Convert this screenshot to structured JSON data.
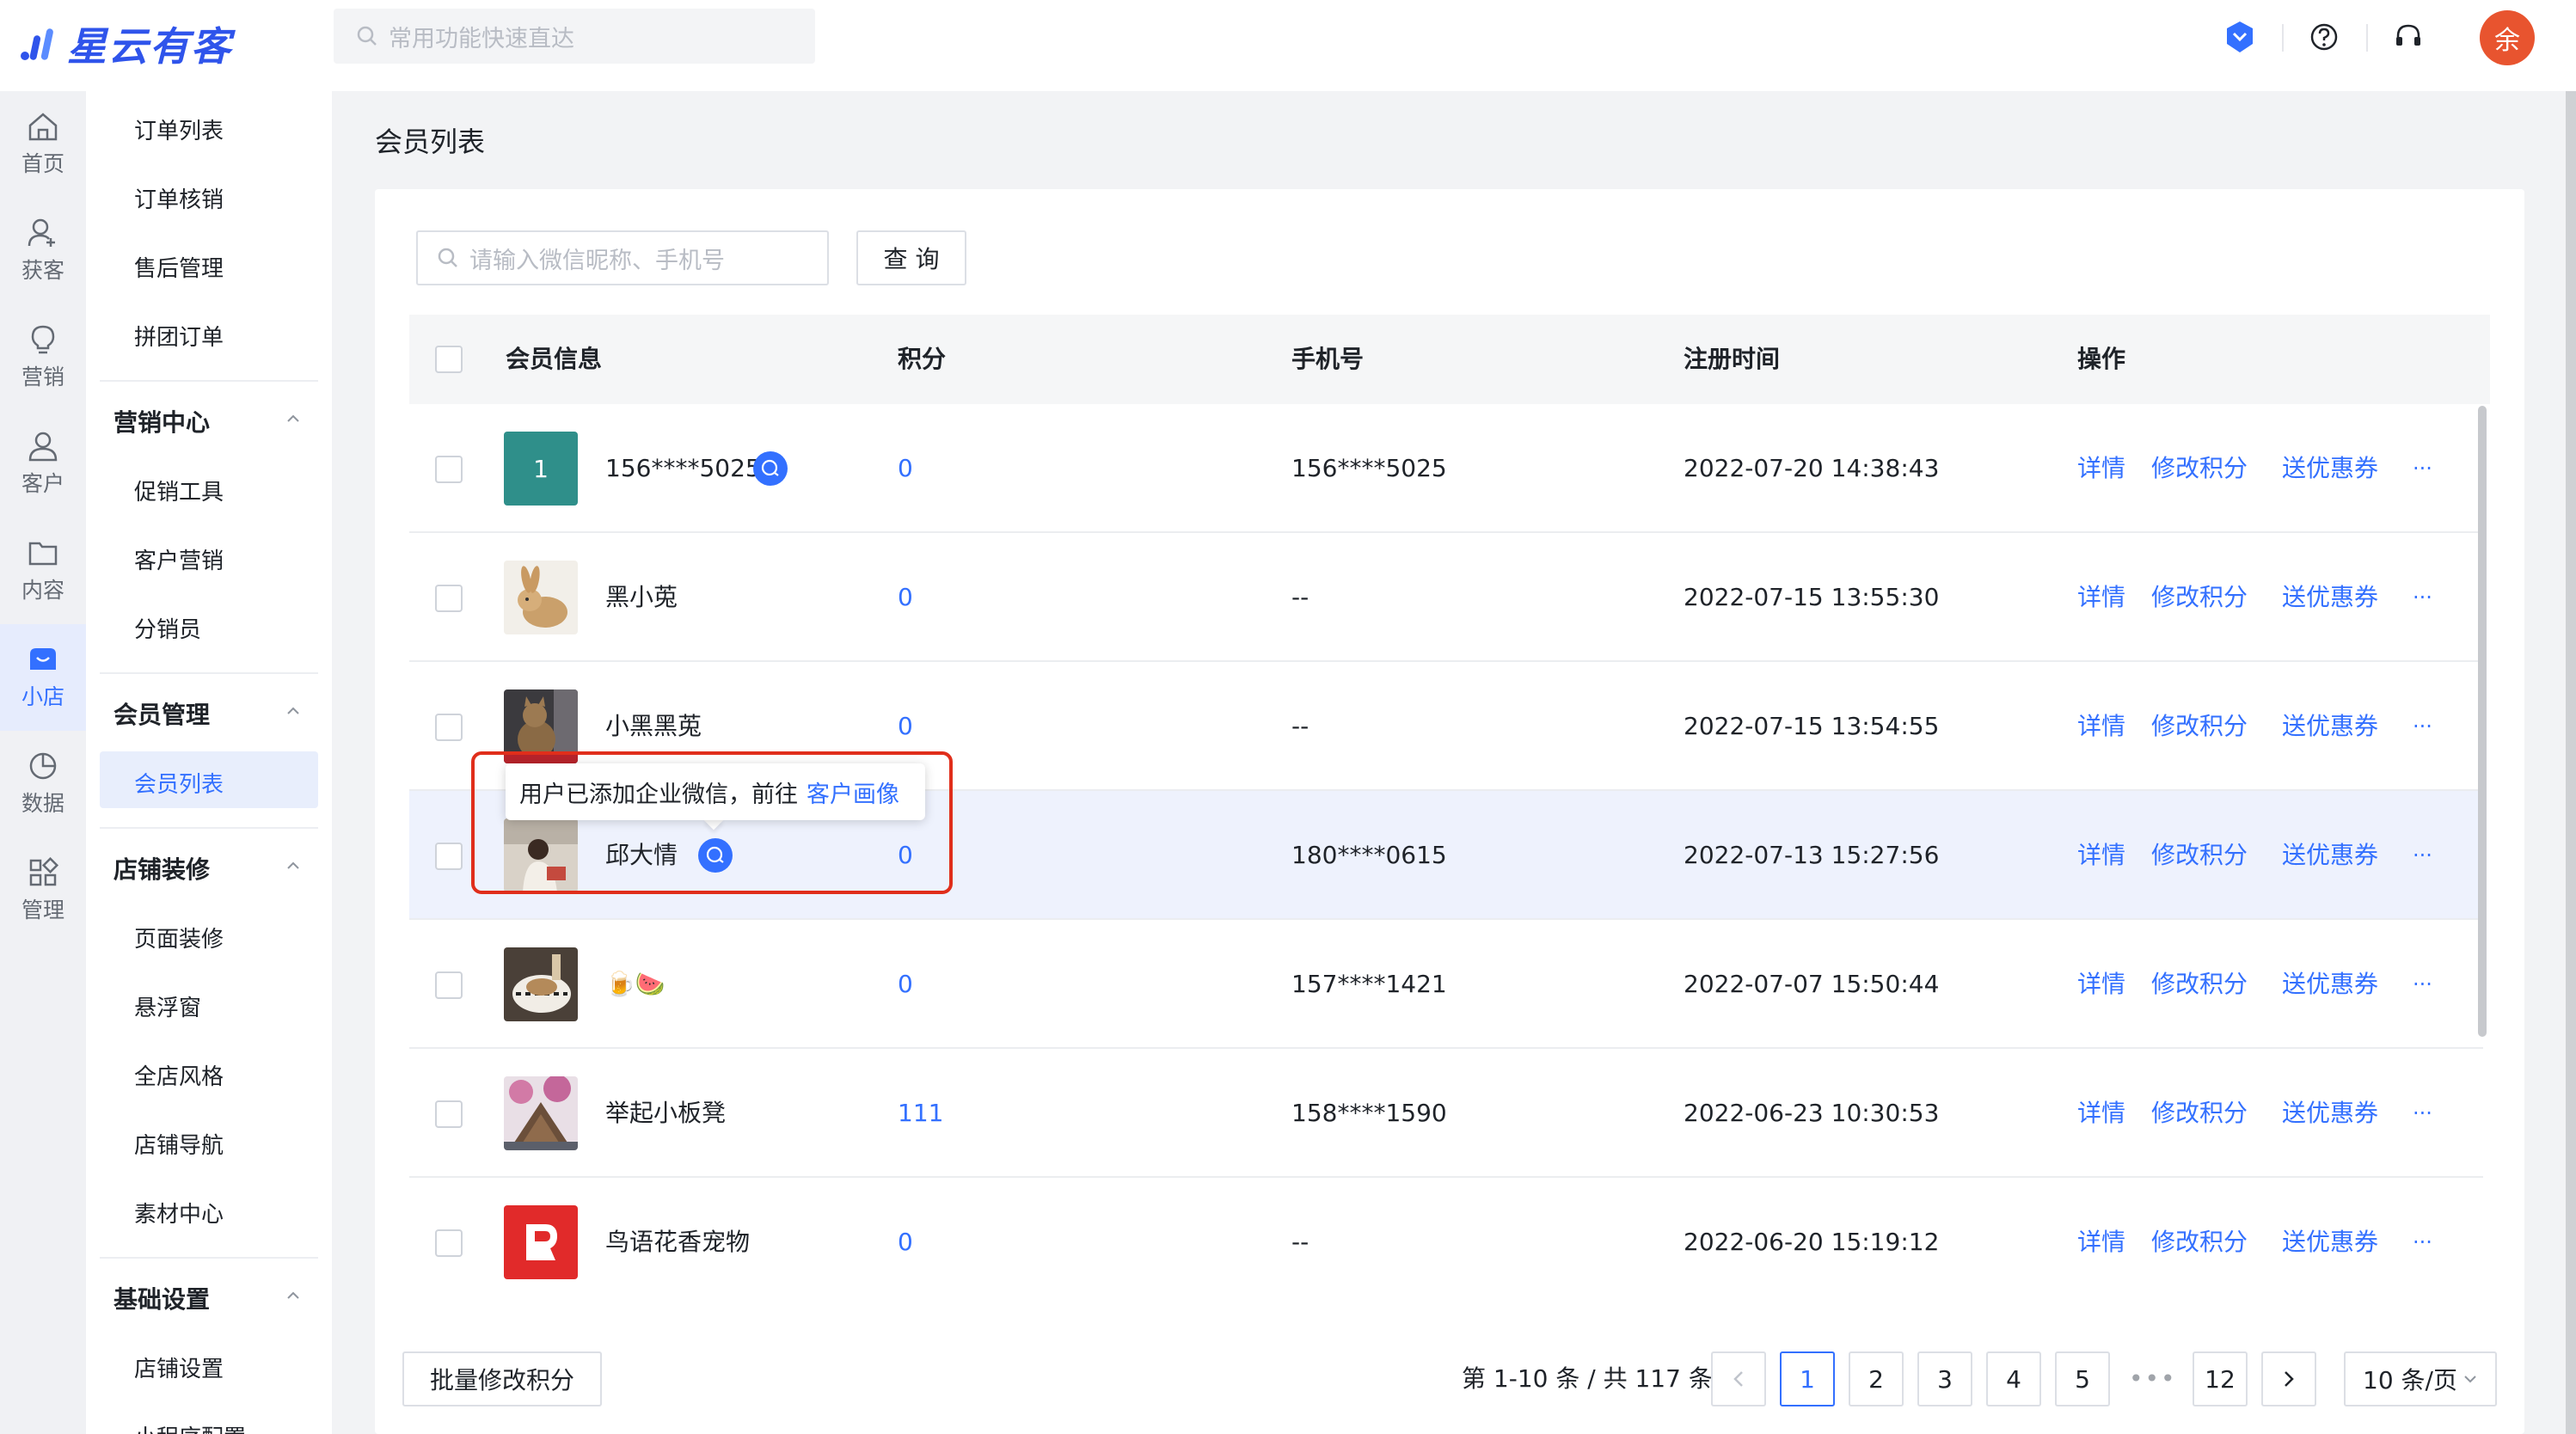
{
  "app": {
    "name": "星云有客"
  },
  "top": {
    "search_placeholder": "常用功能快速直达",
    "user_initial": "余"
  },
  "rail": [
    {
      "label": "首页",
      "icon": "home-icon"
    },
    {
      "label": "获客",
      "icon": "user-plus-icon"
    },
    {
      "label": "营销",
      "icon": "bulb-icon"
    },
    {
      "label": "客户",
      "icon": "user-icon"
    },
    {
      "label": "内容",
      "icon": "folder-icon"
    },
    {
      "label": "小店",
      "icon": "shop-icon"
    },
    {
      "label": "数据",
      "icon": "pie-chart-icon"
    },
    {
      "label": "管理",
      "icon": "grid-icon"
    }
  ],
  "sidebar": {
    "order_items": [
      "订单列表",
      "订单核销",
      "售后管理",
      "拼团订单"
    ],
    "marketing": {
      "title": "营销中心",
      "items": [
        "促销工具",
        "客户营销",
        "分销员"
      ]
    },
    "member": {
      "title": "会员管理",
      "items": [
        "会员列表"
      ]
    },
    "decor": {
      "title": "店铺装修",
      "items": [
        "页面装修",
        "悬浮窗",
        "全店风格",
        "店铺导航",
        "素材中心"
      ]
    },
    "basic": {
      "title": "基础设置",
      "items": [
        "店铺设置",
        "小程序配置"
      ]
    }
  },
  "page": {
    "title": "会员列表"
  },
  "search": {
    "placeholder": "请输入微信昵称、手机号",
    "button": "查 询"
  },
  "table": {
    "columns": [
      "会员信息",
      "积分",
      "手机号",
      "注册时间",
      "操作"
    ],
    "actions": [
      "详情",
      "修改积分",
      "送优惠券",
      "···"
    ],
    "rows": [
      {
        "name": "156****5025",
        "thumb": "1",
        "points": "0",
        "phone": "156****5025",
        "time": "2022-07-20 14:38:43",
        "wechat": true
      },
      {
        "name": "黑小莵",
        "points": "0",
        "phone": "--",
        "time": "2022-07-15 13:55:30",
        "wechat": false
      },
      {
        "name": "小黑黑莵",
        "points": "0",
        "phone": "--",
        "time": "2022-07-15 13:54:55",
        "wechat": false
      },
      {
        "name": "邱大情",
        "points": "0",
        "phone": "180****0615",
        "time": "2022-07-13 15:27:56",
        "wechat": true
      },
      {
        "name": "🍺🍉",
        "points": "0",
        "phone": "157****1421",
        "time": "2022-07-07 15:50:44",
        "wechat": false
      },
      {
        "name": "举起小板凳",
        "points": "111",
        "phone": "158****1590",
        "time": "2022-06-23 10:30:53",
        "wechat": false
      },
      {
        "name": "鸟语花香宠物",
        "points": "0",
        "phone": "--",
        "time": "2022-06-20 15:19:12",
        "wechat": false
      }
    ]
  },
  "tooltip": {
    "text": "用户已添加企业微信，前往",
    "link": "客户画像"
  },
  "footer": {
    "batch_button": "批量修改积分",
    "total_text": "第 1-10 条 / 共 117 条",
    "pages": [
      "1",
      "2",
      "3",
      "4",
      "5"
    ],
    "ellipsis": "•••",
    "last_page": "12",
    "page_size": "10 条/页"
  },
  "colors": {
    "primary": "#3370ff",
    "avatar": "#e8542f",
    "annotation": "#e02e1b"
  }
}
